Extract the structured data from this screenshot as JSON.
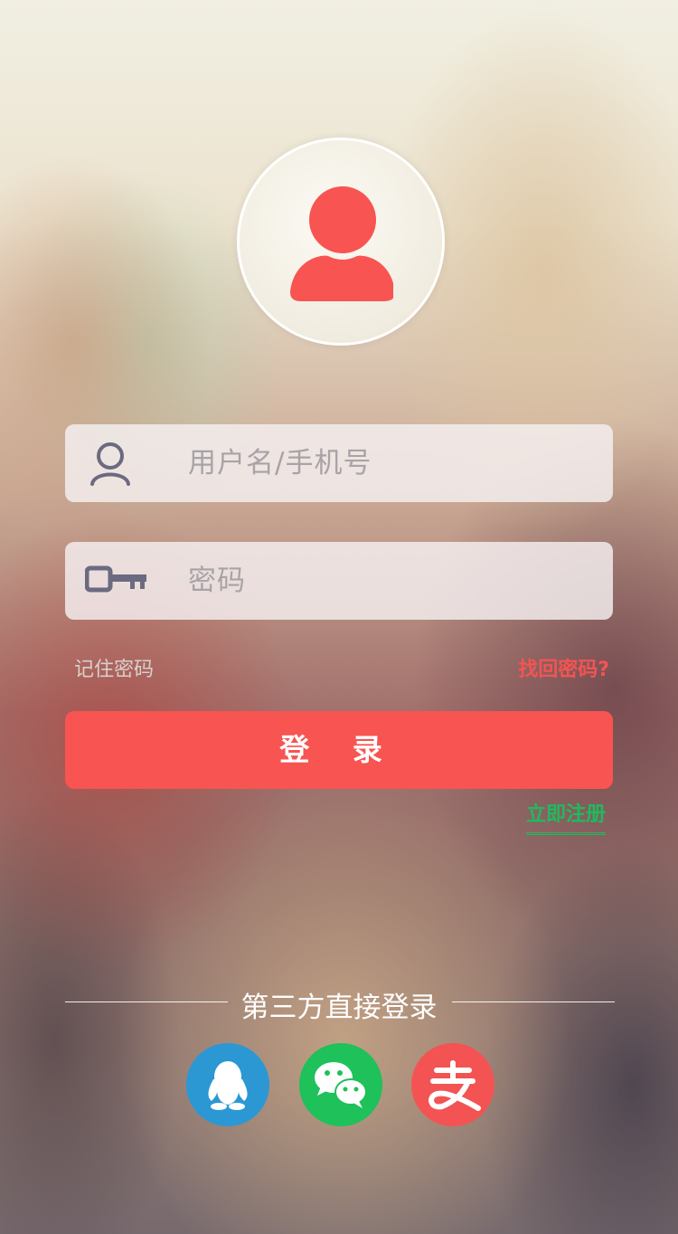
{
  "login_form": {
    "username_placeholder": "用户名/手机号",
    "password_placeholder": "密码",
    "remember_label": "记住密码",
    "forgot_label": "找回密码?",
    "login_button_label": "登 录",
    "register_label": "立即注册"
  },
  "third_party": {
    "title": "第三方直接登录",
    "providers": [
      {
        "name": "qq-icon",
        "color": "#2b98d4"
      },
      {
        "name": "wechat-icon",
        "color": "#1ec15a"
      },
      {
        "name": "alipay-icon",
        "color": "#f45353"
      }
    ]
  },
  "colors": {
    "accent": "#f75452",
    "register_green": "#1dbb5e",
    "field_icon": "#6c6a80"
  }
}
